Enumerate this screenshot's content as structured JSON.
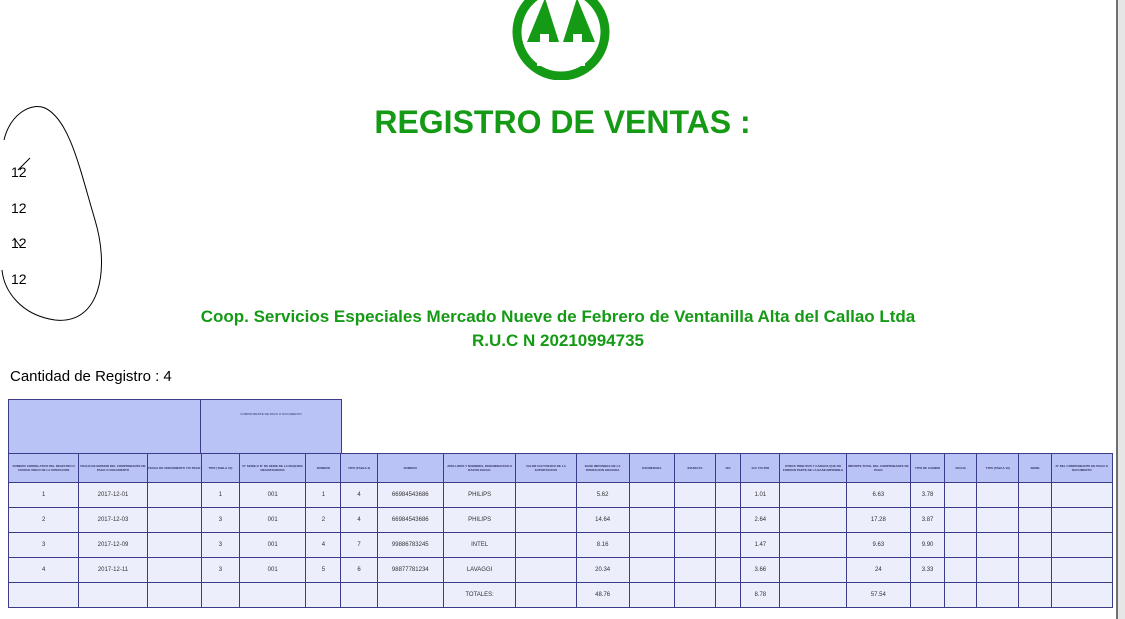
{
  "title": "REGISTRO DE VENTAS :",
  "company": "Coop. Servicios Especiales Mercado Nueve de Febrero de Ventanilla Alta del Callao Ltda",
  "ruc": "R.U.C N 20210994735",
  "count_label": "Cantidad de Registro : 4",
  "side_numbers": [
    "12",
    "12",
    "12",
    "12"
  ],
  "colors": {
    "green": "#159a15",
    "header": "#b9c3f5",
    "row": "#eceefb"
  },
  "icons": {
    "logo": "twin-pine-trees-logo",
    "annotation": "handwritten-loop"
  },
  "table": {
    "group_header": "COMPROBANTE DE PAGO O DOCUMENTO",
    "columns": [
      "NUMERO CORRELATIVO DEL REGISTRO O CODIGO UNICO DE LA OPERACION",
      "FECHA DE EMISION DEL COMPROBANTE DE PAGO O DOCUMENTO",
      "FECHA DE VENCIMIENTO Y/O PAGO",
      "TIPO (TABLA 10)",
      "N° SERIE O N° DE SERIE DE LA MAQUINA REGISTRADORA",
      "NUMERO",
      "TIPO (TABLA 2)",
      "NUMERO",
      "APELLIDOS Y NOMBRES, DENOMINACION O RAZON SOCIAL",
      "VALOR FACTURADO DE LA EXPORTACION",
      "BASE IMPONIBLE DE LA OPERACION GRAVADA",
      "EXONERADA",
      "INAFECTA",
      "ISC",
      "IGV Y/O IPM",
      "OTROS TRIBUTOS Y CARGOS QUE NO FORMAN PARTE DE LA BASE IMPONIBLE",
      "IMPORTE TOTAL DEL COMPROBANTE DE PAGO",
      "TIPO DE CAMBIO",
      "FECHA",
      "TIPO (TABLA 10)",
      "SERIE",
      "N° DEL COMPROBANTE DE PAGO O DOCUMENTO"
    ],
    "rows": [
      [
        "1",
        "2017-12-01",
        "",
        "1",
        "001",
        "1",
        "4",
        "66984543686",
        "PHILIPS",
        "",
        "5.62",
        "",
        "",
        "",
        "1.01",
        "",
        "6.63",
        "3.78",
        "",
        "",
        "",
        ""
      ],
      [
        "2",
        "2017-12-03",
        "",
        "3",
        "001",
        "2",
        "4",
        "66984543686",
        "PHILIPS",
        "",
        "14.64",
        "",
        "",
        "",
        "2.64",
        "",
        "17.28",
        "3.87",
        "",
        "",
        "",
        ""
      ],
      [
        "3",
        "2017-12-09",
        "",
        "3",
        "001",
        "4",
        "7",
        "99886783245",
        "INTEL",
        "",
        "8.16",
        "",
        "",
        "",
        "1.47",
        "",
        "9.63",
        "9.90",
        "",
        "",
        "",
        ""
      ],
      [
        "4",
        "2017-12-11",
        "",
        "3",
        "001",
        "5",
        "6",
        "98877781234",
        "LAVAGGI",
        "",
        "20.34",
        "",
        "",
        "",
        "3.66",
        "",
        "24",
        "3.33",
        "",
        "",
        "",
        ""
      ],
      [
        "",
        "",
        "",
        "",
        "",
        "",
        "",
        "",
        "TOTALES:",
        "",
        "48.76",
        "",
        "",
        "",
        "8.78",
        "",
        "57.54",
        "",
        "",
        "",
        "",
        ""
      ]
    ]
  }
}
